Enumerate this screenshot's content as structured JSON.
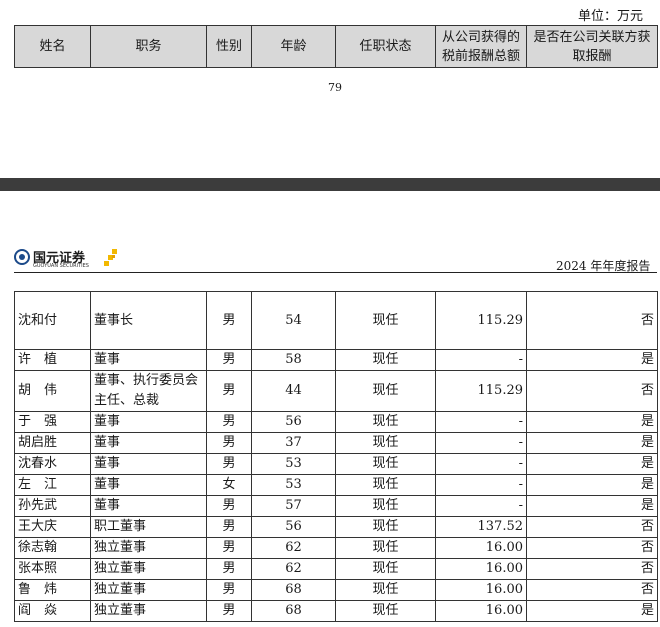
{
  "unit_label": "单位：万元",
  "header": {
    "columns": [
      "姓名",
      "职务",
      "性别",
      "年龄",
      "任职状态",
      "从公司获得的税前报酬总额",
      "是否在公司关联方获取报酬"
    ]
  },
  "page_number": "79",
  "page_header": {
    "logo_cn": "国元证券",
    "logo_en": "GUOYUAN SECURITIES",
    "report_title": "2024 年年度报告"
  },
  "rows": [
    {
      "name": "沈和付",
      "title": "董事长",
      "gender": "男",
      "age": "54",
      "status": "现任",
      "pay": "115.29",
      "related": "否"
    },
    {
      "name": "许　植",
      "title": "董事",
      "gender": "男",
      "age": "58",
      "status": "现任",
      "pay": "-",
      "related": "是"
    },
    {
      "name": "胡　伟",
      "title": "董事、执行委员会主任、总裁",
      "gender": "男",
      "age": "44",
      "status": "现任",
      "pay": "115.29",
      "related": "否"
    },
    {
      "name": "于　强",
      "title": "董事",
      "gender": "男",
      "age": "56",
      "status": "现任",
      "pay": "-",
      "related": "是"
    },
    {
      "name": "胡启胜",
      "title": "董事",
      "gender": "男",
      "age": "37",
      "status": "现任",
      "pay": "-",
      "related": "是"
    },
    {
      "name": "沈春水",
      "title": "董事",
      "gender": "男",
      "age": "53",
      "status": "现任",
      "pay": "-",
      "related": "是"
    },
    {
      "name": "左　江",
      "title": "董事",
      "gender": "女",
      "age": "53",
      "status": "现任",
      "pay": "-",
      "related": "是"
    },
    {
      "name": "孙先武",
      "title": "董事",
      "gender": "男",
      "age": "57",
      "status": "现任",
      "pay": "-",
      "related": "是"
    },
    {
      "name": "王大庆",
      "title": "职工董事",
      "gender": "男",
      "age": "56",
      "status": "现任",
      "pay": "137.52",
      "related": "否"
    },
    {
      "name": "徐志翰",
      "title": "独立董事",
      "gender": "男",
      "age": "62",
      "status": "现任",
      "pay": "16.00",
      "related": "否"
    },
    {
      "name": "张本照",
      "title": "独立董事",
      "gender": "男",
      "age": "62",
      "status": "现任",
      "pay": "16.00",
      "related": "否"
    },
    {
      "name": "鲁　炜",
      "title": "独立董事",
      "gender": "男",
      "age": "68",
      "status": "现任",
      "pay": "16.00",
      "related": "否"
    },
    {
      "name": "阎　焱",
      "title": "独立董事",
      "gender": "男",
      "age": "68",
      "status": "现任",
      "pay": "16.00",
      "related": "是"
    }
  ]
}
